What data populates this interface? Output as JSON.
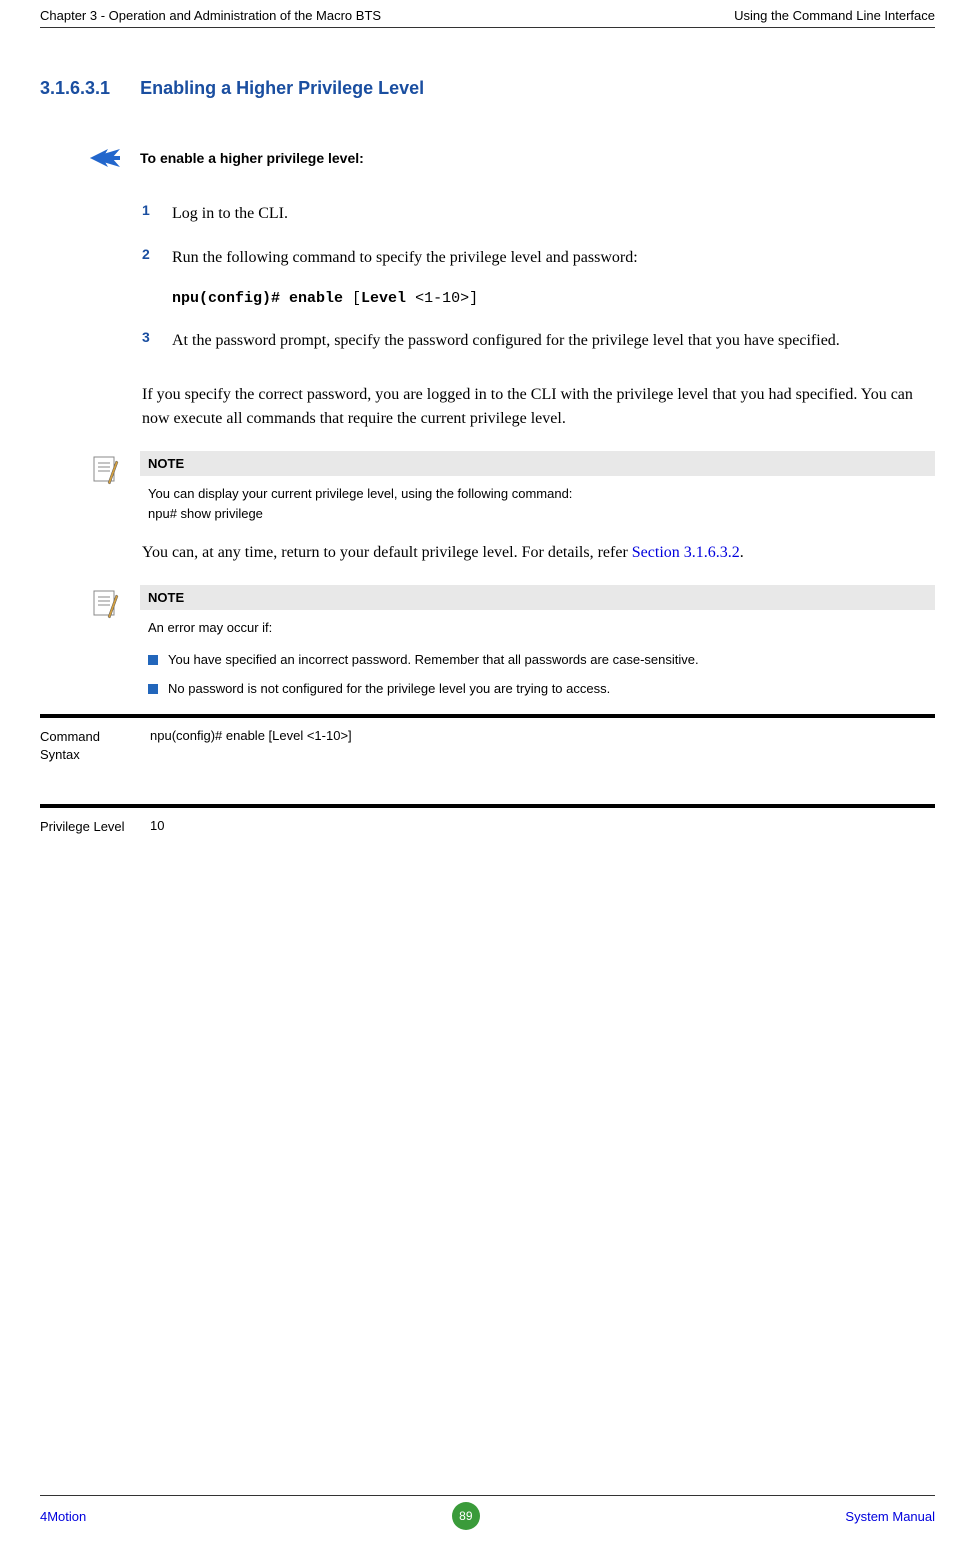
{
  "header": {
    "left": "Chapter 3 - Operation and Administration of the Macro BTS",
    "right": "Using the Command Line Interface"
  },
  "section": {
    "number": "3.1.6.3.1",
    "title": "Enabling a Higher Privilege Level"
  },
  "instruction": {
    "title": "To enable a higher privilege level:"
  },
  "steps": {
    "s1": {
      "num": "1",
      "text": "Log in to the CLI."
    },
    "s2": {
      "num": "2",
      "text": "Run the following command to specify the privilege level and password:"
    },
    "s3": {
      "num": "3",
      "text": "At the password prompt, specify the password configured for the privilege level that you have specified."
    }
  },
  "code": {
    "part1": "npu(config)# enable",
    "part2": " [",
    "part3": "Level",
    "part4": " <1-10>]"
  },
  "body": {
    "p1": "If you specify the correct password, you are logged in to the CLI with the privilege level that you had specified. You can now execute all commands that require the current privilege level.",
    "p2a": "You can, at any time, return to your default privilege level. For details, refer ",
    "p2link": "Section 3.1.6.3.2",
    "p2b": "."
  },
  "note1": {
    "header": "NOTE",
    "line1": "You can display your current privilege level, using the following command:",
    "line2": "npu# show privilege"
  },
  "note2": {
    "header": "NOTE",
    "intro": "An error may occur if:",
    "bullet1": "You have specified an incorrect password. Remember that all passwords are case-sensitive.",
    "bullet2": "No password is not configured for the privilege level you are trying to access."
  },
  "table": {
    "row1": {
      "label": "Command Syntax",
      "value": "npu(config)# enable [Level <1-10>]"
    },
    "row2": {
      "label": "Privilege Level",
      "value": "10"
    }
  },
  "footer": {
    "left": "4Motion",
    "page": "89",
    "right": "System Manual"
  }
}
